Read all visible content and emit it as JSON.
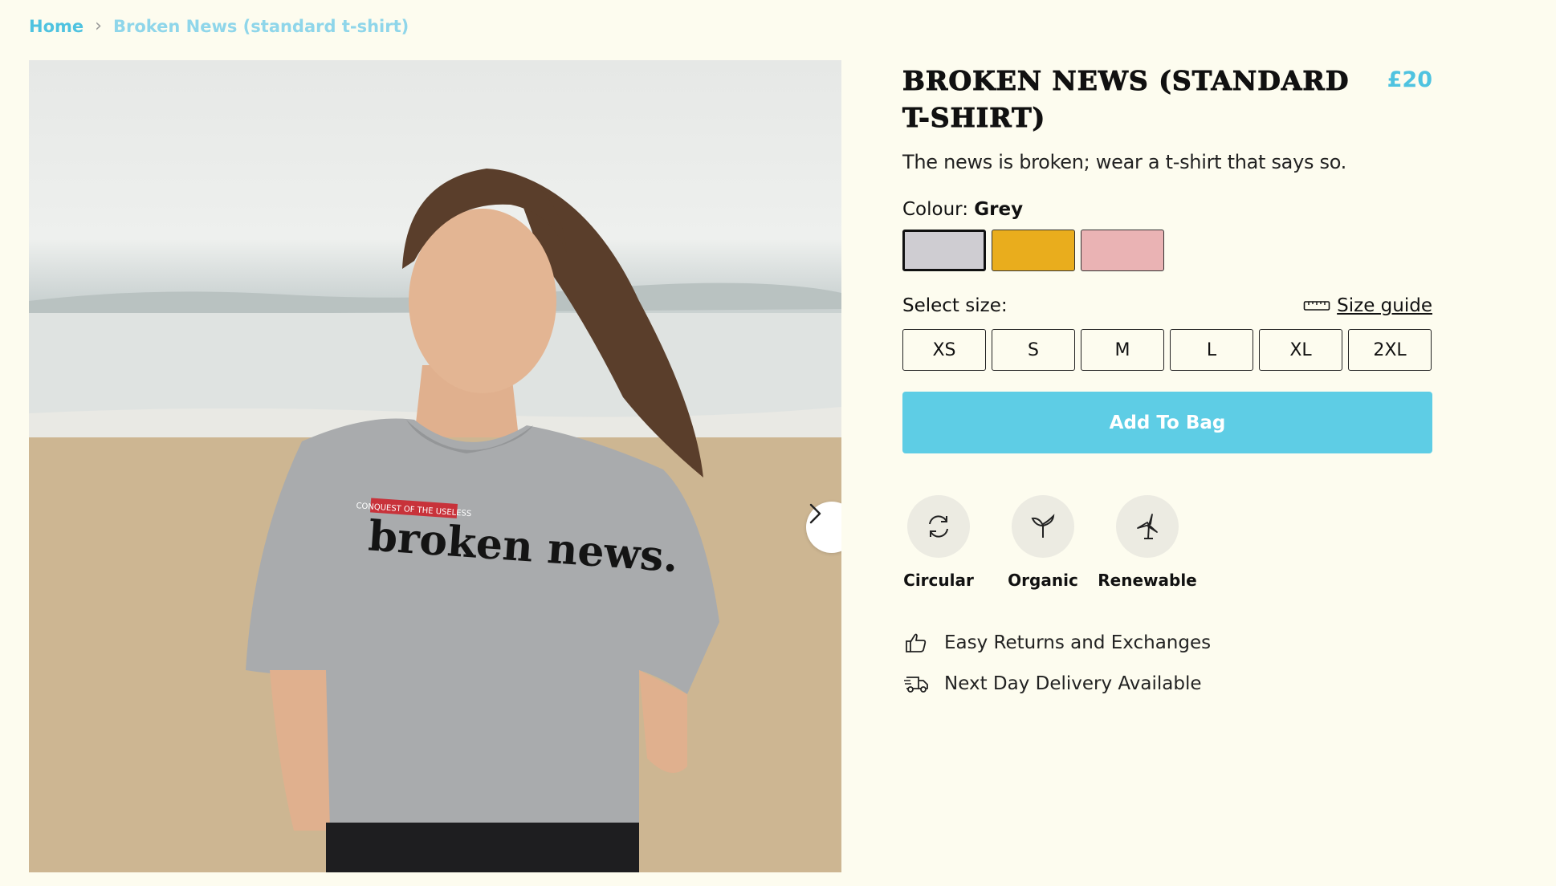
{
  "breadcrumb": {
    "home": "Home",
    "separator": "›",
    "current": "Broken News (standard t-shirt)"
  },
  "gallery": {
    "next_icon": "chevron-right-icon",
    "print": {
      "badge": "CONQUEST OF THE USELESS",
      "headline": "broken news."
    }
  },
  "product": {
    "title": "Broken News (standard t-shirt)",
    "price": "£20",
    "description": "The news is broken; wear a t-shirt that says so."
  },
  "colour": {
    "label": "Colour:",
    "selected": "Grey",
    "swatches": [
      {
        "name": "Grey",
        "hex": "#cfcdd2"
      },
      {
        "name": "Mustard",
        "hex": "#e9ad1d"
      },
      {
        "name": "Pink",
        "hex": "#eab3b4"
      }
    ]
  },
  "size": {
    "label": "Select size:",
    "guide": "Size guide",
    "guide_icon": "ruler-icon",
    "options": [
      "XS",
      "S",
      "M",
      "L",
      "XL",
      "2XL"
    ]
  },
  "cta": {
    "add_to_bag": "Add To Bag"
  },
  "features": [
    {
      "label": "Circular",
      "icon": "recycle-icon"
    },
    {
      "label": "Organic",
      "icon": "sprout-icon"
    },
    {
      "label": "Renewable",
      "icon": "wind-turbine-icon"
    }
  ],
  "perks": [
    {
      "label": "Easy Returns and Exchanges",
      "icon": "thumbs-up-icon"
    },
    {
      "label": "Next Day Delivery Available",
      "icon": "delivery-truck-icon"
    }
  ],
  "colors": {
    "background": "#fdfcef",
    "accent": "#5ecde5",
    "link": "#4fc3e0"
  }
}
